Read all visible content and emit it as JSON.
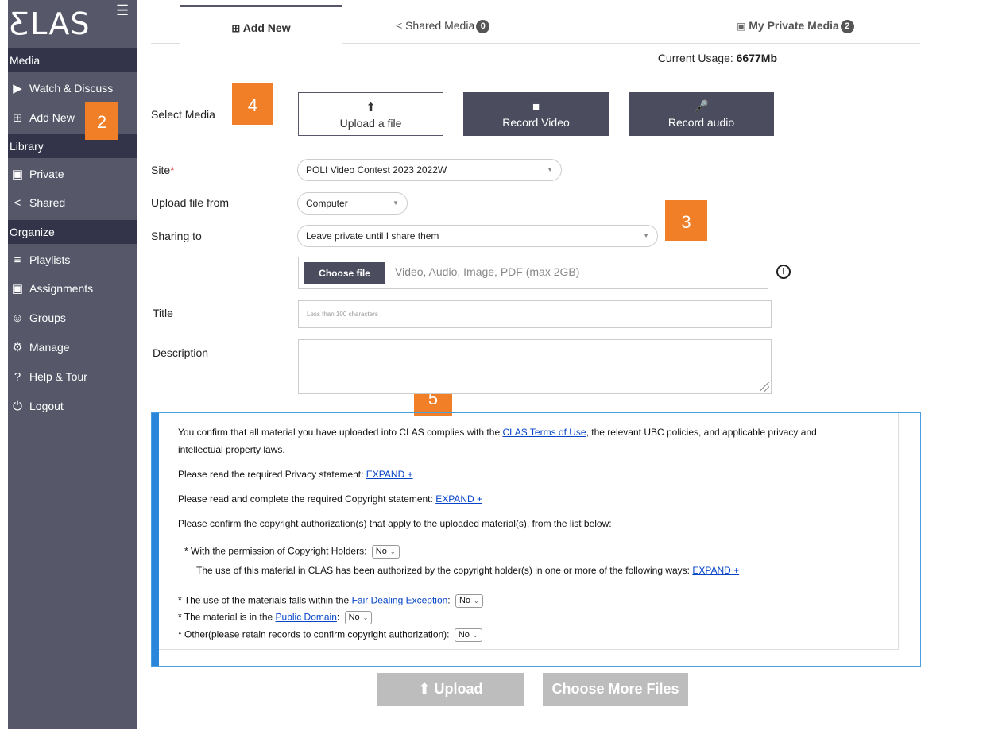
{
  "sidebar": {
    "logo": "ƸLAS",
    "menu_icon": "hamburger-icon",
    "sections": {
      "media": "Media",
      "library": "Library",
      "organize": "Organize"
    },
    "items": [
      {
        "label": "Watch & Discuss",
        "icon": "play-box-icon"
      },
      {
        "label": "Add New",
        "icon": "plus-box-icon"
      },
      {
        "label": "Private",
        "icon": "lock-icon"
      },
      {
        "label": "Shared",
        "icon": "share-icon"
      },
      {
        "label": "Playlists",
        "icon": "list-icon"
      },
      {
        "label": "Assignments",
        "icon": "assignment-icon"
      },
      {
        "label": "Groups",
        "icon": "groups-icon"
      },
      {
        "label": "Manage",
        "icon": "gear-icon"
      },
      {
        "label": "Help & Tour",
        "icon": "help-icon"
      },
      {
        "label": "Logout",
        "icon": "power-icon"
      }
    ]
  },
  "callouts": {
    "n2": "2",
    "n3": "3",
    "n4": "4",
    "n5": "5",
    "color": "#f07f28"
  },
  "tabs": [
    {
      "label": "Add New",
      "count": null,
      "active": true
    },
    {
      "label": "Shared Media",
      "count": "0"
    },
    {
      "label": "My Private Media",
      "count": "2"
    }
  ],
  "usage": {
    "label": "Current Usage:",
    "value": "6677Mb"
  },
  "form": {
    "select_media_label": "Select Media",
    "upload_label": "Upload a file",
    "record_video_label": "Record Video",
    "record_audio_label": "Record audio",
    "site_label": "Site",
    "site_value": "POLI Video Contest 2023 2022W",
    "upload_from_label": "Upload file from",
    "upload_from_value": "Computer",
    "sharing_label": "Sharing to",
    "sharing_value": "Leave private until I share them",
    "choose_file": "Choose file",
    "file_hint": "Video, Audio, Image, PDF (max 2GB)",
    "title_label": "Title",
    "title_placeholder": "Less than 100 characters",
    "description_label": "Description"
  },
  "agreement": {
    "line1_pre": "You confirm that all material you have uploaded into CLAS complies with the ",
    "line1_link": "CLAS Terms of Use",
    "line1_post": ", the relevant UBC policies, and applicable privacy and",
    "line2": "intellectual property laws.",
    "privacy_pre": "Please read the required Privacy statement: ",
    "copyright_pre": "Please read and complete the required Copyright statement: ",
    "expand": "EXPAND +",
    "confirm_text": "Please confirm the copyright authorization(s) that apply to the uploaded material(s), from the list below:",
    "holders_label": "* With the permission of Copyright Holders:",
    "holders_desc": "The use of this material in CLAS has been authorized by the copyright holder(s) in one or more of the following ways: ",
    "fair_pre": "* The use of the materials falls within the ",
    "fair_link": "Fair Dealing Exception",
    "public_pre": "* The material is in the ",
    "public_link": "Public Domain",
    "other_label": "* Other(please retain records to confirm copyright authorization):",
    "colon": ":",
    "no": "No"
  },
  "buttons": {
    "upload": "Upload",
    "more": "Choose More Files"
  }
}
